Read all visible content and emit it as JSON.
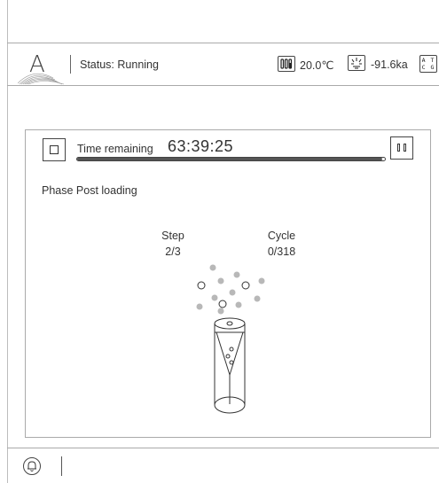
{
  "header": {
    "logo_letter": "A",
    "status": "Status: Running",
    "temperature_icon": "thermometer-icon",
    "temperature": "20.0℃",
    "vacuum_icon": "pressure-icon",
    "pressure": "-91.6ka",
    "atcg_icon": "dna-icon",
    "atcg_top": "A T",
    "atcg_bottom": "C G"
  },
  "run": {
    "time_label": "Time remaining",
    "time_value": "63:39:25",
    "progress_fraction": 0.99,
    "phase": "Phase Post loading",
    "step_label": "Step",
    "step_value": "2/3",
    "cycle_label": "Cycle",
    "cycle_value": "0/318"
  },
  "footer": {
    "bell_icon": "bell-icon"
  }
}
